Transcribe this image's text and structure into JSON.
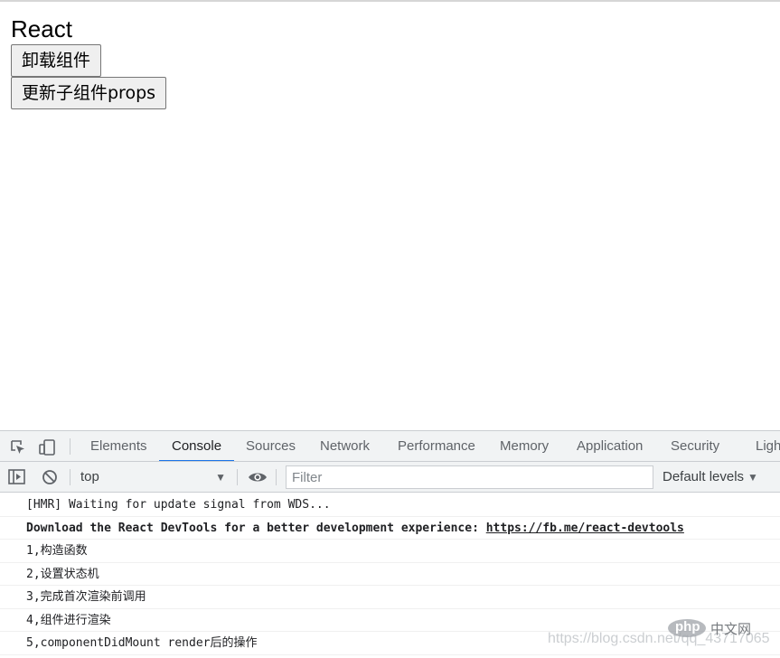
{
  "app": {
    "title": "React",
    "unmount_button": "卸载组件",
    "update_props_button": "更新子组件props"
  },
  "devtools": {
    "tabs": [
      {
        "label": "Elements"
      },
      {
        "label": "Console",
        "active": true
      },
      {
        "label": "Sources"
      },
      {
        "label": "Network"
      },
      {
        "label": "Performance"
      },
      {
        "label": "Memory"
      },
      {
        "label": "Application"
      },
      {
        "label": "Security"
      },
      {
        "label": "Ligh"
      }
    ],
    "toolbar": {
      "context": "top",
      "filter_placeholder": "Filter",
      "levels": "Default levels"
    },
    "console": {
      "messages": [
        {
          "text": "[HMR] Waiting for update signal from WDS..."
        },
        {
          "text": "Download the React DevTools for a better development experience: ",
          "link": "https://fb.me/react-devtools",
          "bold": true
        },
        {
          "text": "1,构造函数"
        },
        {
          "text": "2,设置状态机"
        },
        {
          "text": "3,完成首次渲染前调用"
        },
        {
          "text": "4,组件进行渲染"
        },
        {
          "text": "5,componentDidMount render后的操作"
        }
      ]
    },
    "icons": {
      "inspect": "inspect-element-icon",
      "device": "device-toolbar-icon",
      "sidebar": "show-sidebar-icon",
      "clear": "clear-console-icon",
      "eye": "live-expression-eye-icon"
    }
  },
  "watermark": {
    "logo_php": "php",
    "logo_cn": "中文网",
    "url": "https://blog.csdn.net/qq_43717065"
  },
  "colors": {
    "accent": "#1a73e8",
    "toolbar_bg": "#f1f3f4",
    "border": "#cacdd1"
  }
}
